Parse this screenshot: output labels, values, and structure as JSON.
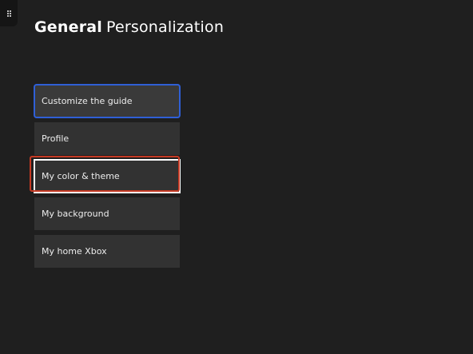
{
  "header": {
    "section": "General",
    "page_title": "Personalization"
  },
  "menu": {
    "items": [
      {
        "label": "Customize the guide"
      },
      {
        "label": "Profile"
      },
      {
        "label": "My color & theme"
      },
      {
        "label": "My background"
      },
      {
        "label": "My home Xbox"
      }
    ]
  },
  "colors": {
    "background": "#1f1f1f",
    "tile": "#323232",
    "focus_ring": "#2f5fd6",
    "callout": "#c53a24"
  },
  "icons": {
    "corner": "grip-dots-icon"
  }
}
